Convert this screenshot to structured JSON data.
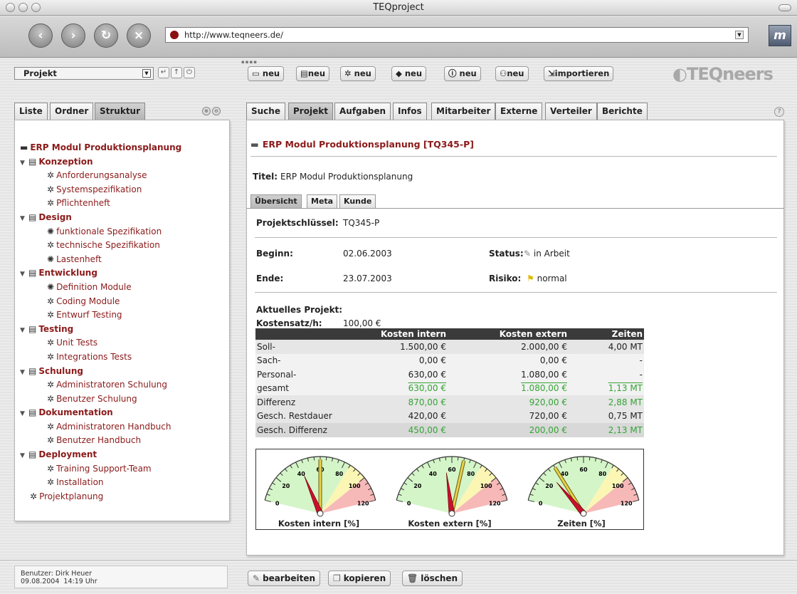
{
  "window": {
    "title": "TEQproject"
  },
  "browser": {
    "url": "http://www.teqneers.de/",
    "logo": "m"
  },
  "toolbar": {
    "project_select": "Projekt",
    "buttons": [
      {
        "label": "neu",
        "icon": "folder-icon"
      },
      {
        "label": "neu",
        "icon": "document-icon"
      },
      {
        "label": "neu",
        "icon": "gear-icon"
      },
      {
        "label": "neu",
        "icon": "diamond-icon"
      },
      {
        "label": "neu",
        "icon": "info-icon"
      },
      {
        "label": "neu",
        "icon": "people-icon"
      },
      {
        "label": "importieren",
        "icon": "import-icon"
      }
    ],
    "brand": "TEQneers"
  },
  "left": {
    "tabs": [
      "Liste",
      "Ordner",
      "Struktur"
    ],
    "active_tab": "Struktur",
    "tree": [
      {
        "label": "ERP Modul Produktionsplanung",
        "level": 0,
        "icon": "folder-icon"
      },
      {
        "label": "Konzeption",
        "level": 1,
        "icon": "document-icon"
      },
      {
        "label": "Anforderungsanalyse",
        "level": 2,
        "icon": "gear-icon"
      },
      {
        "label": "Systemspezifikation",
        "level": 2,
        "icon": "gear-icon"
      },
      {
        "label": "Pflichtenheft",
        "level": 2,
        "icon": "gear-icon"
      },
      {
        "label": "Design",
        "level": 1,
        "icon": "document-icon"
      },
      {
        "label": "funktionale Spezifikation",
        "level": 2,
        "icon": "gears-icon"
      },
      {
        "label": "technische Spezifikation",
        "level": 2,
        "icon": "gear-icon"
      },
      {
        "label": "Lastenheft",
        "level": 2,
        "icon": "gears-icon"
      },
      {
        "label": "Entwicklung",
        "level": 1,
        "icon": "document-icon"
      },
      {
        "label": "Definition Module",
        "level": 2,
        "icon": "gears-icon"
      },
      {
        "label": "Coding Module",
        "level": 2,
        "icon": "gear-icon"
      },
      {
        "label": "Entwurf Testing",
        "level": 2,
        "icon": "gear-icon"
      },
      {
        "label": "Testing",
        "level": 1,
        "icon": "document-icon"
      },
      {
        "label": "Unit Tests",
        "level": 2,
        "icon": "gear-icon"
      },
      {
        "label": "Integrations Tests",
        "level": 2,
        "icon": "gear-icon"
      },
      {
        "label": "Schulung",
        "level": 1,
        "icon": "document-icon"
      },
      {
        "label": "Administratoren Schulung",
        "level": 2,
        "icon": "gear-icon"
      },
      {
        "label": "Benutzer Schulung",
        "level": 2,
        "icon": "gear-icon"
      },
      {
        "label": "Dokumentation",
        "level": 1,
        "icon": "document-icon"
      },
      {
        "label": "Administratoren Handbuch",
        "level": 2,
        "icon": "gear-icon"
      },
      {
        "label": "Benutzer Handbuch",
        "level": 2,
        "icon": "gear-icon"
      },
      {
        "label": "Deployment",
        "level": 1,
        "icon": "document-icon"
      },
      {
        "label": "Training Support-Team",
        "level": 2,
        "icon": "gear-icon"
      },
      {
        "label": "Installation",
        "level": 2,
        "icon": "gear-icon"
      },
      {
        "label": "Projektplanung",
        "level": 3,
        "icon": "gear-icon"
      }
    ]
  },
  "main": {
    "tabs": [
      "Suche",
      "Projekt",
      "Aufgaben",
      "Infos",
      "Mitarbeiter",
      "Externe",
      "Verteiler",
      "Berichte"
    ],
    "active_tab": "Projekt",
    "project_heading": "ERP Modul Produktionsplanung [TQ345-P]",
    "titel_label": "Titel:",
    "titel_value": "ERP Modul Produktionsplanung",
    "subtabs": [
      "Übersicht",
      "Meta",
      "Kunde"
    ],
    "active_subtab": "Übersicht",
    "key_label": "Projektschlüssel:",
    "key_value": "TQ345-P",
    "beginn_label": "Beginn:",
    "beginn_value": "02.06.2003",
    "ende_label": "Ende:",
    "ende_value": "23.07.2003",
    "status_label": "Status:",
    "status_value": "in Arbeit",
    "risiko_label": "Risiko:",
    "risiko_value": "normal",
    "aktuelles_label": "Aktuelles Projekt:",
    "kostensatz_label": "Kostensatz/h:",
    "kostensatz_value": "100,00 €",
    "table": {
      "headers": [
        "",
        "Kosten intern",
        "Kosten extern",
        "Zeiten"
      ],
      "rows": [
        {
          "label": "Soll-",
          "intern": "1.500,00 €",
          "extern": "2.000,00 €",
          "zeiten": "4,00 MT",
          "style": "g"
        },
        {
          "label": "Sach-",
          "intern": "0,00 €",
          "extern": "0,00 €",
          "zeiten": "-",
          "style": "w"
        },
        {
          "label": "Personal-",
          "intern": "630,00 €",
          "extern": "1.080,00 €",
          "zeiten": "-",
          "style": "w"
        },
        {
          "label": "gesamt",
          "intern": "630,00 €",
          "extern": "1.080,00 €",
          "zeiten": "1,13 MT",
          "style": "w",
          "green": true,
          "overline": true
        },
        {
          "label": "Differenz",
          "intern": "870,00 €",
          "extern": "920,00 €",
          "zeiten": "2,88 MT",
          "style": "g",
          "green": true
        },
        {
          "label": "Gesch. Restdauer",
          "intern": "420,00 €",
          "extern": "720,00 €",
          "zeiten": "0,75 MT",
          "style": "g"
        },
        {
          "label": "Gesch. Differenz",
          "intern": "450,00 €",
          "extern": "200,00 €",
          "zeiten": "2,13 MT",
          "style": "s",
          "green": true
        }
      ]
    },
    "gauges": [
      {
        "label": "Kosten intern [%]",
        "value": 42,
        "target": 60
      },
      {
        "label": "Kosten extern [%]",
        "value": 54,
        "target": 70
      },
      {
        "label": "Zeiten [%]",
        "value": 28,
        "target": 35
      }
    ],
    "gauge_ticks": [
      "0",
      "20",
      "40",
      "60",
      "80",
      "100",
      "120"
    ]
  },
  "footer": {
    "user": "Benutzer: Dirk Heuer",
    "datetime": "09.08.2004  14:19 Uhr",
    "buttons": [
      "bearbeiten",
      "kopieren",
      "löschen"
    ]
  }
}
